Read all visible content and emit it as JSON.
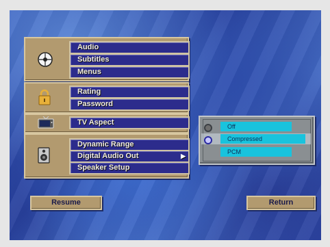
{
  "menu": {
    "disc_group": {
      "icon": "disc-icon",
      "items": [
        {
          "label": "Audio"
        },
        {
          "label": "Subtitles"
        },
        {
          "label": "Menus"
        }
      ]
    },
    "lock_group": {
      "icon": "padlock-icon",
      "items": [
        {
          "label": "Rating"
        },
        {
          "label": "Password"
        }
      ]
    },
    "tv_group": {
      "icon": "tv-icon",
      "items": [
        {
          "label": "TV Aspect"
        }
      ]
    },
    "speaker_group": {
      "icon": "speaker-icon",
      "items": [
        {
          "label": "Dynamic Range"
        },
        {
          "label": "Digital Audio Out",
          "has_submenu": true
        },
        {
          "label": "Speaker Setup"
        }
      ]
    }
  },
  "options": {
    "items": [
      {
        "label": "Off",
        "selected": false
      },
      {
        "label": "Compressed",
        "selected": true
      },
      {
        "label": "PCM",
        "selected": false
      }
    ],
    "submenu_arrow": "▶"
  },
  "bottom": {
    "resume_label": "Resume",
    "return_label": "Return"
  },
  "colors": {
    "panel": "#b29a6f",
    "button": "#2c2c8c",
    "option_highlight": "#19c3dd",
    "background_blue": "#3457b8"
  }
}
